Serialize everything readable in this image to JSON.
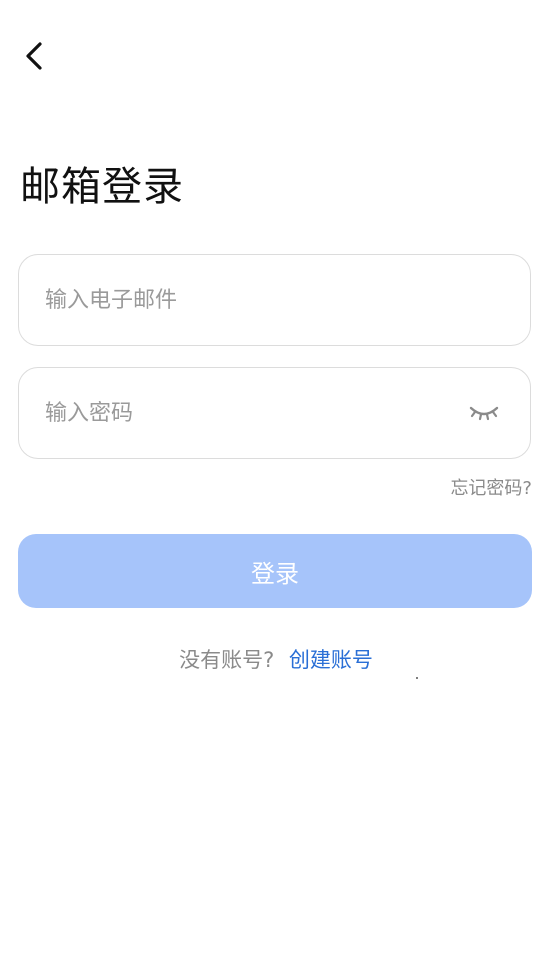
{
  "header": {
    "back_icon": "chevron-left-icon",
    "title": "邮箱登录"
  },
  "form": {
    "email_placeholder": "输入电子邮件",
    "email_value": "",
    "password_placeholder": "输入密码",
    "password_value": "",
    "password_toggle_icon": "eye-closed-icon",
    "forgot_label": "忘记密码?"
  },
  "login_button": {
    "label": "登录",
    "color": "#a6c4fa",
    "state": "disabled"
  },
  "signup": {
    "prompt": "没有账号?",
    "link_label": "创建账号",
    "link_color": "#2a6fd6"
  }
}
